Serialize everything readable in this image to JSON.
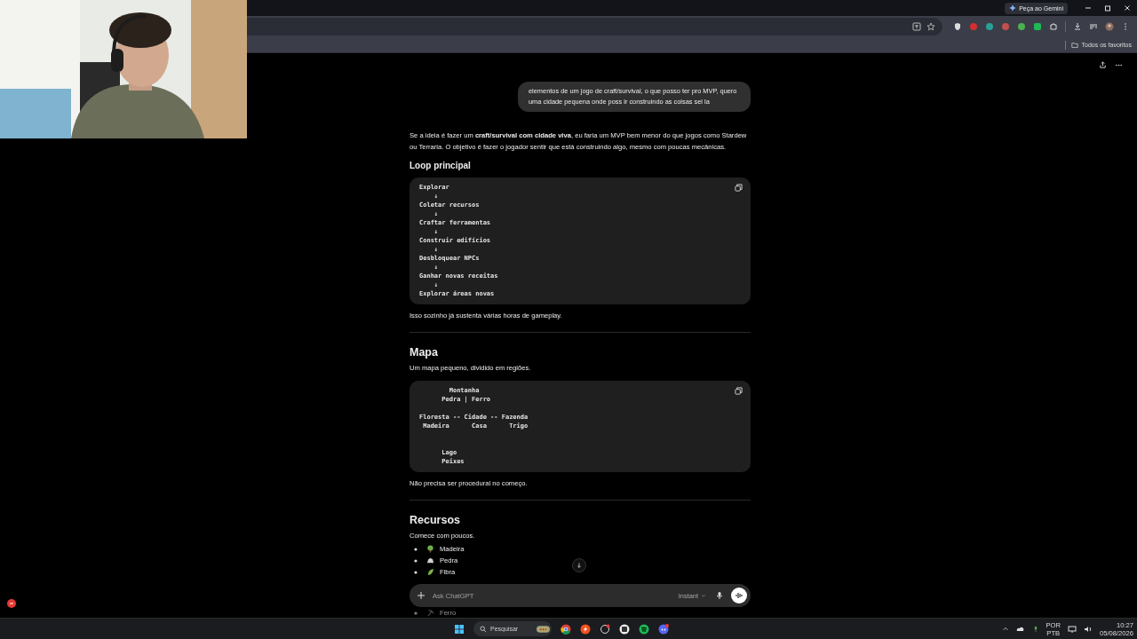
{
  "browser": {
    "gemini_button": "Peça ao Gemini",
    "bookmarks_folder": "Todos os favoritos"
  },
  "chat": {
    "user_message": "elementos de um jogo de  craft/survival, o que posso ter pro MVP, quero uma cidade pequena onde poss ir construindo as coisas sei la",
    "blocks": [
      {
        "kind": "paragraph",
        "text": "Se a ideia é fazer um **craft/survival com cidade viva**, eu faria um MVP bem menor do que jogos como Stardew ou Terraria. O objetivo é fazer o jogador sentir que está construindo algo, mesmo com poucas mecânicas."
      },
      {
        "kind": "subheading",
        "text": "Loop principal"
      },
      {
        "kind": "code",
        "text": "Explorar\n    ↓\nColetar recursos\n    ↓\nCraftar ferramentas\n    ↓\nConstruir edifícios\n    ↓\nDesbloquear NPCs\n    ↓\nGanhar novas receitas\n    ↓\nExplorar áreas novas"
      },
      {
        "kind": "paragraph",
        "text": "Isso sozinho já sustenta várias horas de gameplay."
      },
      {
        "kind": "rule"
      },
      {
        "kind": "heading",
        "text": "Mapa"
      },
      {
        "kind": "paragraph",
        "text": "Um mapa pequeno, dividido em regiões."
      },
      {
        "kind": "code",
        "text": "        Montanha\n      Pedra | Ferro\n\nFloresta -- Cidade -- Fazenda\n Madeira      Casa      Trigo\n\n\n      Lago\n      Peixes"
      },
      {
        "kind": "paragraph",
        "text": "Não precisa ser procedural no começo."
      },
      {
        "kind": "rule"
      },
      {
        "kind": "heading",
        "text": "Recursos"
      },
      {
        "kind": "paragraph",
        "text": "Comece com poucos."
      },
      {
        "kind": "list",
        "items": [
          {
            "kind": "tree",
            "text": "Madeira"
          },
          {
            "kind": "rock",
            "text": "Pedra"
          },
          {
            "kind": "leaf",
            "text": "Fibra"
          }
        ]
      },
      {
        "kind": "list_under_composer",
        "items": [
          {
            "kind": "pick",
            "text": "Ferro"
          }
        ]
      }
    ]
  },
  "composer": {
    "placeholder": "Ask ChatGPT",
    "model": "Instant"
  },
  "taskbar": {
    "search_placeholder": "Pesquisar",
    "language": "POR",
    "layout": "PTB",
    "time": "10:27",
    "date": "05/08/2026"
  }
}
